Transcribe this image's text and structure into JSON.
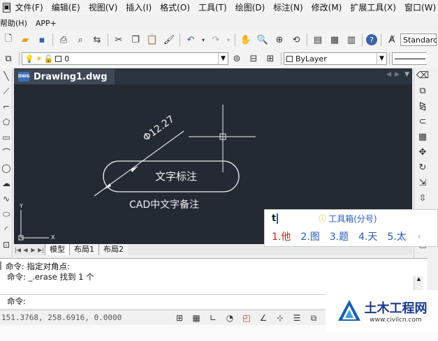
{
  "menubar": {
    "items": [
      "文件(F)",
      "编辑(E)",
      "视图(V)",
      "插入(I)",
      "格式(O)",
      "工具(T)",
      "绘图(D)",
      "标注(N)",
      "修改(M)",
      "扩展工具(X)",
      "窗口(W)"
    ]
  },
  "submenu": {
    "help": "帮助(H)",
    "app": "APP+"
  },
  "toolbar": {
    "textstyle": "Standarc",
    "layer_value": "0",
    "color_value": "ByLayer"
  },
  "document": {
    "tab_title": "Drawing1.dwg",
    "icon_text": "DWG"
  },
  "drawing": {
    "dim_text": "Φ12.27",
    "slot_label": "文字标注",
    "note_label": "CAD中文字备注",
    "ucs_y": "Y",
    "ucs_x": "X"
  },
  "layouts": {
    "tabs": [
      "模型",
      "布局1",
      "布局2"
    ]
  },
  "command": {
    "history": [
      "命令: 指定对角点:",
      "命令: _.erase 找到 1 个"
    ],
    "prompt": "命令:"
  },
  "status": {
    "coords": "151.3768, 258.6916, 0.0000"
  },
  "ime": {
    "input": "t",
    "hint": "工具箱(分号)",
    "candidates": [
      "1.他",
      "2.图",
      "3.题",
      "4.天",
      "5.太"
    ]
  },
  "watermark": {
    "brand": "土木工程网",
    "url": "www.civilcn.com"
  }
}
